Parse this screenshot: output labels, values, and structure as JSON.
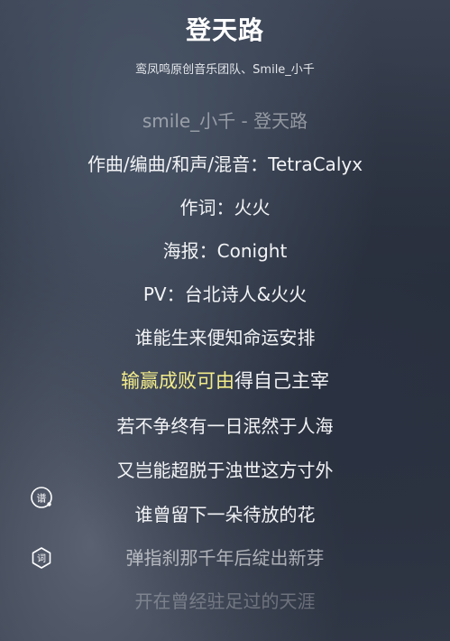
{
  "song": {
    "title": "登天路",
    "artist": "鸾凤鸣原创音乐团队、Smile_小千"
  },
  "lyrics": [
    {
      "text": "smile_小千 - 登天路"
    },
    {
      "text": "作曲/编曲/和声/混音：TetraCalyx"
    },
    {
      "text": "作词：火火"
    },
    {
      "text": "海报：Conight"
    },
    {
      "text": "PV：台北诗人&火火"
    },
    {
      "text": "谁能生来便知命运安排"
    },
    {
      "sung": "输赢成败可由",
      "rest": "得自己主宰"
    },
    {
      "text": "若不争终有一日泯然于人海"
    },
    {
      "text": "又岂能超脱于浊世这方寸外"
    },
    {
      "text": "谁曾留下一朵待放的花"
    },
    {
      "text": "弹指刹那千年后绽出新芽"
    },
    {
      "text": "开在曾经驻足过的天涯"
    }
  ],
  "colors": {
    "sung": "#f3ec8a",
    "lyric": "#f2f3f5"
  },
  "controls": {
    "sheet_icon": "music-sheet-icon",
    "lyric_icon": "lyric-settings-icon",
    "sheet_label": "谱",
    "lyric_label": "词"
  }
}
